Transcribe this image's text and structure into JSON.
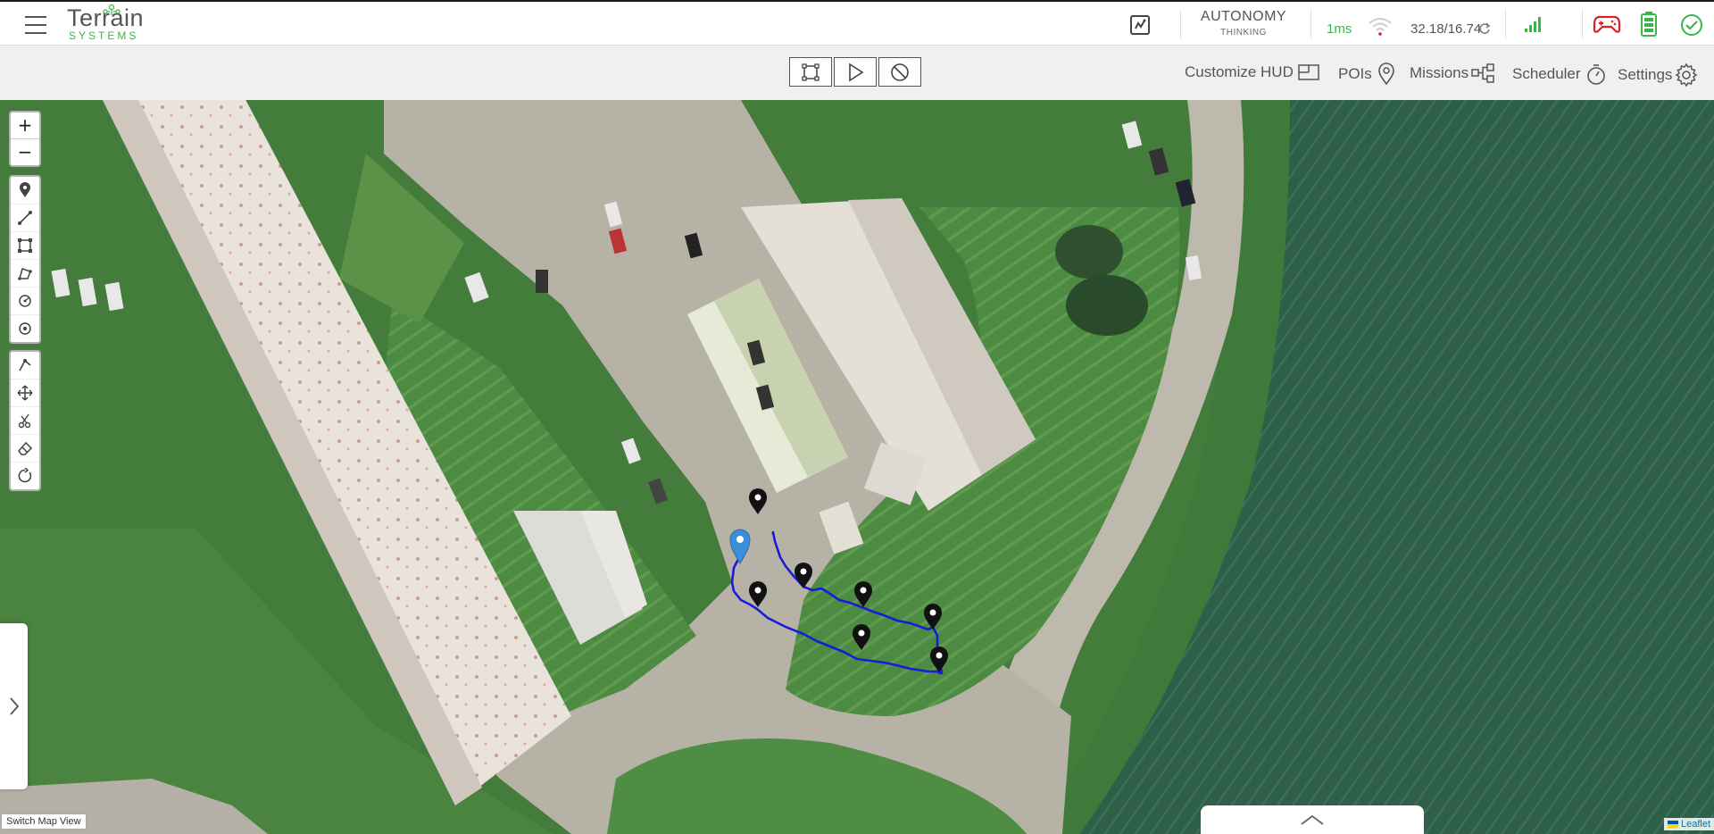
{
  "brand": {
    "name_top": "Terrain",
    "name_bottom": "SYSTEMS"
  },
  "status": {
    "autonomy_label": "AUTONOMY",
    "autonomy_state": "THINKING",
    "latency": "1ms",
    "version": "32.18/16.74"
  },
  "toolbar": {
    "customize_hud": "Customize HUD",
    "pois": "POIs",
    "missions": "Missions",
    "scheduler": "Scheduler",
    "settings": "Settings"
  },
  "map": {
    "zoom_in": "+",
    "zoom_out": "−",
    "switch_view": "Switch Map View",
    "attribution": "Leaflet"
  },
  "colors": {
    "accent_green": "#3ab54a",
    "route_blue": "#1a1adb",
    "alert_red": "#e02020"
  }
}
